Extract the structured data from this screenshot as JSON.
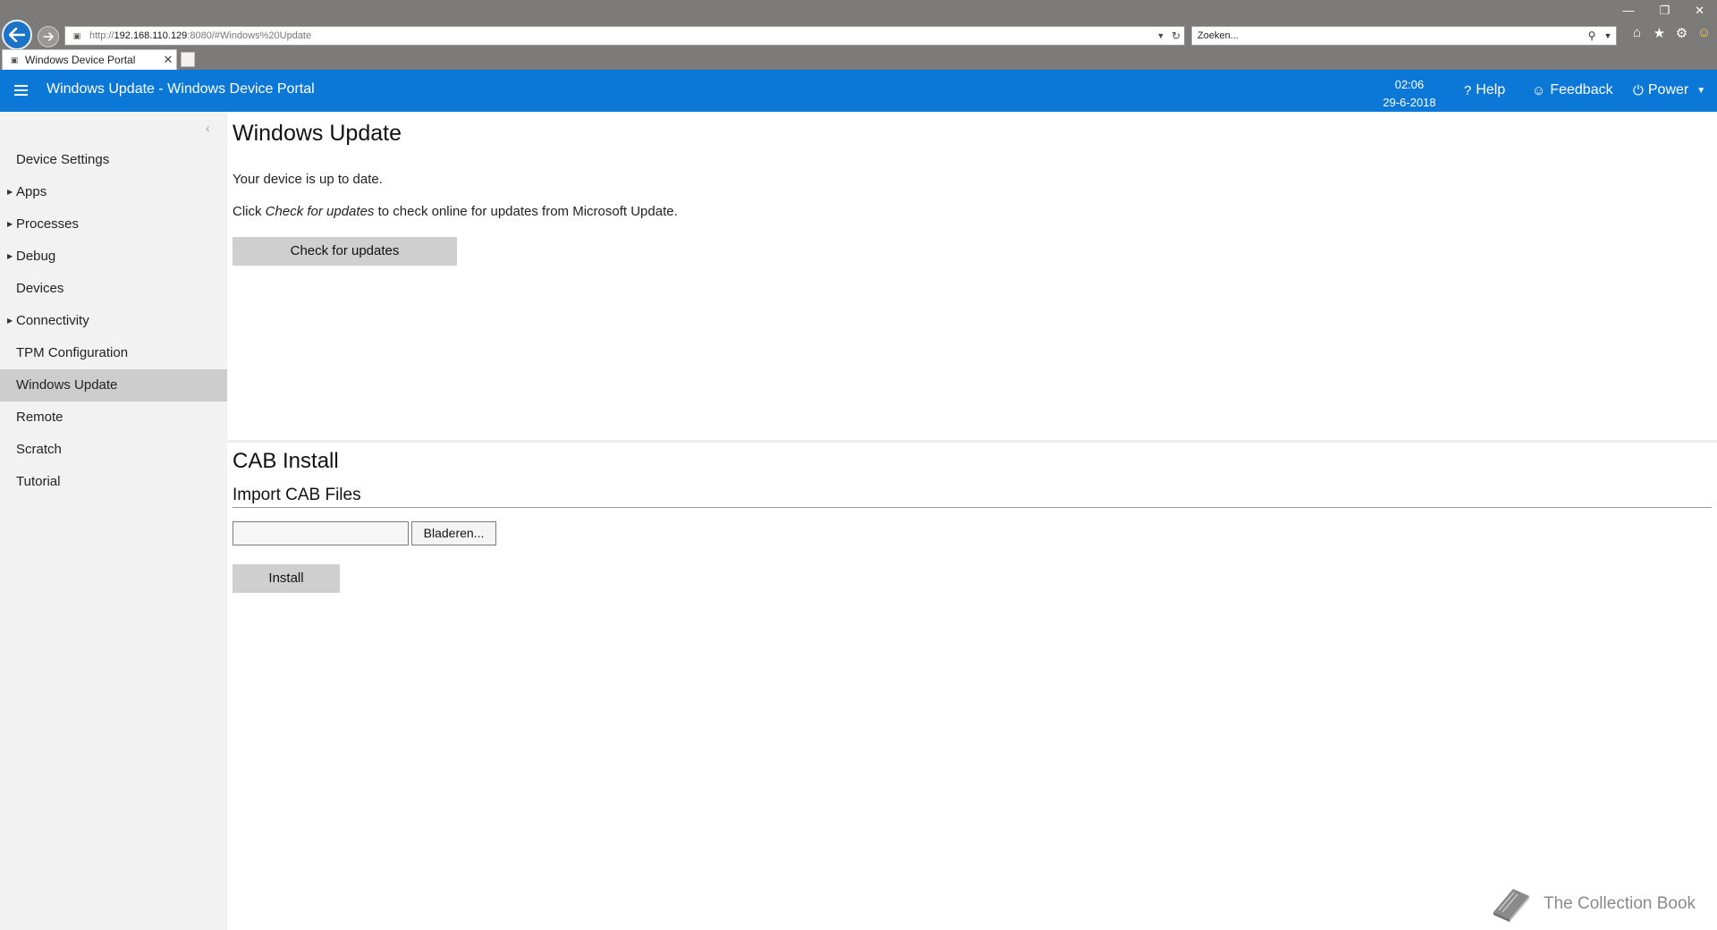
{
  "browser": {
    "address_host_prefix": "http://",
    "address_host": "192.168.110.129",
    "address_rest": ":8080/#Windows%20Update",
    "search_placeholder": "Zoeken...",
    "tab_title": "Windows Device Portal",
    "toolbar_icons": [
      "home-icon",
      "favorites-star-icon",
      "settings-gear-icon",
      "smiley-icon"
    ]
  },
  "header": {
    "title": "Windows Update - Windows Device Portal",
    "time": "02:06",
    "date": "29-6-2018",
    "help_label": "Help",
    "feedback_label": "Feedback",
    "power_label": "Power",
    "accent_color": "#0b78d7"
  },
  "sidebar": {
    "items": [
      {
        "label": "Device Settings",
        "expandable": false
      },
      {
        "label": "Apps",
        "expandable": true
      },
      {
        "label": "Processes",
        "expandable": true
      },
      {
        "label": "Debug",
        "expandable": true
      },
      {
        "label": "Devices",
        "expandable": false
      },
      {
        "label": "Connectivity",
        "expandable": true
      },
      {
        "label": "TPM Configuration",
        "expandable": false
      },
      {
        "label": "Windows Update",
        "expandable": false,
        "selected": true
      },
      {
        "label": "Remote",
        "expandable": false
      },
      {
        "label": "Scratch",
        "expandable": false
      },
      {
        "label": "Tutorial",
        "expandable": false
      }
    ]
  },
  "windows_update": {
    "title": "Windows Update",
    "status": "Your device is up to date.",
    "hint_prefix": "Click ",
    "hint_emphasis": "Check for updates",
    "hint_suffix": " to check online for updates from Microsoft Update.",
    "check_button": "Check for updates"
  },
  "cab_install": {
    "title": "CAB Install",
    "import_title": "Import CAB Files",
    "file_value": "",
    "browse_button": "Bladeren...",
    "install_button": "Install"
  },
  "watermark": {
    "text": "The Collection Book"
  }
}
